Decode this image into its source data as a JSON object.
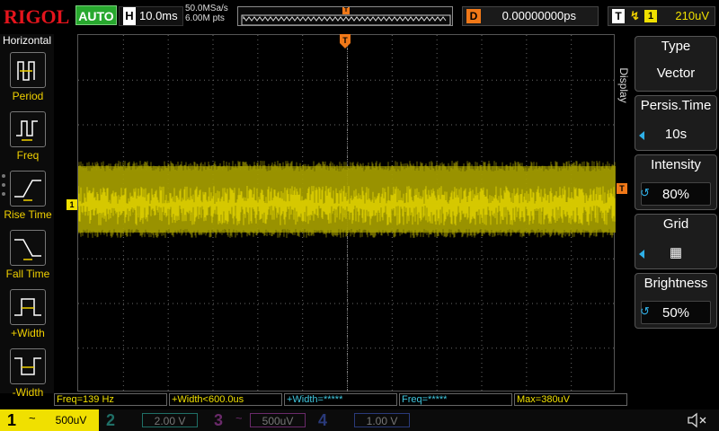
{
  "brand": "RIGOL",
  "run_status": "AUTO",
  "horizontal": {
    "letter": "H",
    "timebase": "10.0ms",
    "sample_rate": "50.0MSa/s",
    "memory_depth": "6.00M pts"
  },
  "delay": {
    "letter": "D",
    "value": "0.00000000ps"
  },
  "trigger": {
    "letter": "T",
    "edge_symbol": "↯",
    "source": "1",
    "level": "210uV"
  },
  "left_menu": {
    "title": "Horizontal",
    "items": [
      {
        "label": "Period",
        "icon": "period-icon"
      },
      {
        "label": "Freq",
        "icon": "freq-icon"
      },
      {
        "label": "Rise Time",
        "icon": "rise-time-icon"
      },
      {
        "label": "Fall Time",
        "icon": "fall-time-icon"
      },
      {
        "label": "+Width",
        "icon": "positive-width-icon"
      },
      {
        "label": "-Width",
        "icon": "negative-width-icon"
      }
    ]
  },
  "right_menu": {
    "side_label": "Display",
    "items": [
      {
        "title": "Type",
        "value": "Vector"
      },
      {
        "title": "Persis.Time",
        "value": "10s"
      },
      {
        "title": "Intensity",
        "value": "80%"
      },
      {
        "title": "Grid",
        "value": "▦"
      },
      {
        "title": "Brightness",
        "value": "50%"
      }
    ]
  },
  "measurements": [
    {
      "text": "Freq=139 Hz",
      "color": "#f0e000"
    },
    {
      "text": "+Width<600.0us",
      "color": "#f0e000"
    },
    {
      "text": "+Width=*****",
      "color": "#40c8e0"
    },
    {
      "text": "Freq=*****",
      "color": "#40c8e0"
    },
    {
      "text": "Max=380uV",
      "color": "#f0e000"
    }
  ],
  "channels": [
    {
      "number": "1",
      "coupling": "~",
      "scale": "500uV",
      "color": "#f0e000",
      "active": true
    },
    {
      "number": "2",
      "coupling": "",
      "scale": "2.00 V",
      "color": "#1f6f66",
      "active": false
    },
    {
      "number": "3",
      "coupling": "~",
      "scale": "500uV",
      "color": "#6a2a6a",
      "active": false
    },
    {
      "number": "4",
      "coupling": "",
      "scale": "1.00 V",
      "color": "#2a3a7a",
      "active": false
    }
  ],
  "markers": {
    "ch1": "1",
    "trig_level": "T",
    "trig_pos": "T"
  },
  "colors": {
    "ch1": "#f0e000",
    "trigger": "#f07818",
    "accent_blue": "#2fb0e8",
    "run_green": "#28a82e",
    "brand_red": "#e4141c"
  }
}
